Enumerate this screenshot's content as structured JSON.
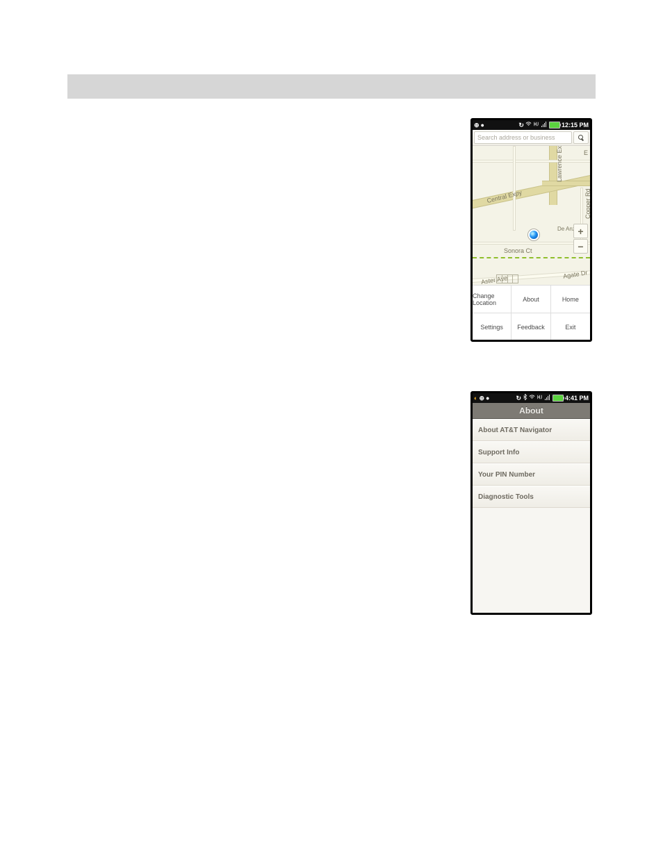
{
  "phone1": {
    "status_time": "12:15 PM",
    "search_placeholder": "Search address or business",
    "map_labels": [
      "E",
      "Central Expy",
      "Lawrence Expy",
      "Copper Rd",
      "De Anza",
      "Sonora Ct",
      "Agate Dr",
      "Aster Ave"
    ],
    "menu": [
      "Change Location",
      "About",
      "Home",
      "Settings",
      "Feedback",
      "Exit"
    ]
  },
  "phone2": {
    "status_time": "4:41 PM",
    "title": "About",
    "items": [
      "About AT&T Navigator",
      "Support Info",
      "Your PIN Number",
      "Diagnostic Tools"
    ]
  }
}
